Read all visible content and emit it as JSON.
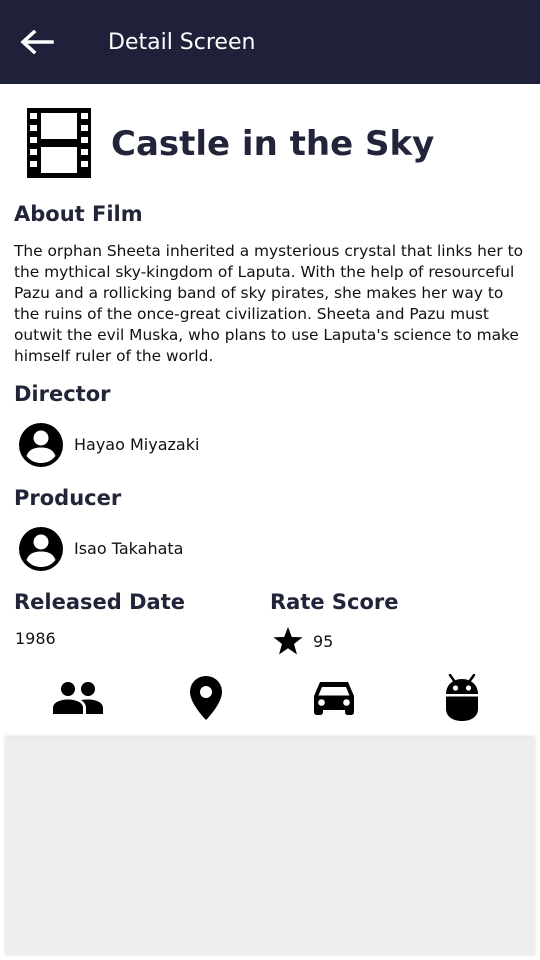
{
  "appbar": {
    "title": "Detail Screen",
    "back_icon": "arrow-left-icon",
    "background": "#1e2139"
  },
  "film": {
    "icon": "film-strip-icon",
    "title": "Castle in the Sky",
    "about_heading": "About Film",
    "description": "The orphan Sheeta inherited a mysterious crystal that links her to the mythical sky-kingdom of Laputa. With the help of resourceful Pazu and a rollicking band of sky pirates, she makes her way to the ruins of the once-great civilization. Sheeta and Pazu must outwit the evil Muska, who plans to use Laputa's science to make himself ruler of the world.",
    "director_heading": "Director",
    "director": "Hayao Miyazaki",
    "producer_heading": "Producer",
    "producer": "Isao Takahata",
    "released_heading": "Released Date",
    "released": "1986",
    "rate_heading": "Rate Score",
    "rate": "95",
    "rate_icon": "star-icon"
  },
  "tabs": [
    {
      "icon": "people-icon"
    },
    {
      "icon": "location-pin-icon"
    },
    {
      "icon": "car-icon"
    },
    {
      "icon": "android-icon"
    }
  ],
  "colors": {
    "heading": "#22243a",
    "panel": "#eeeeee"
  }
}
